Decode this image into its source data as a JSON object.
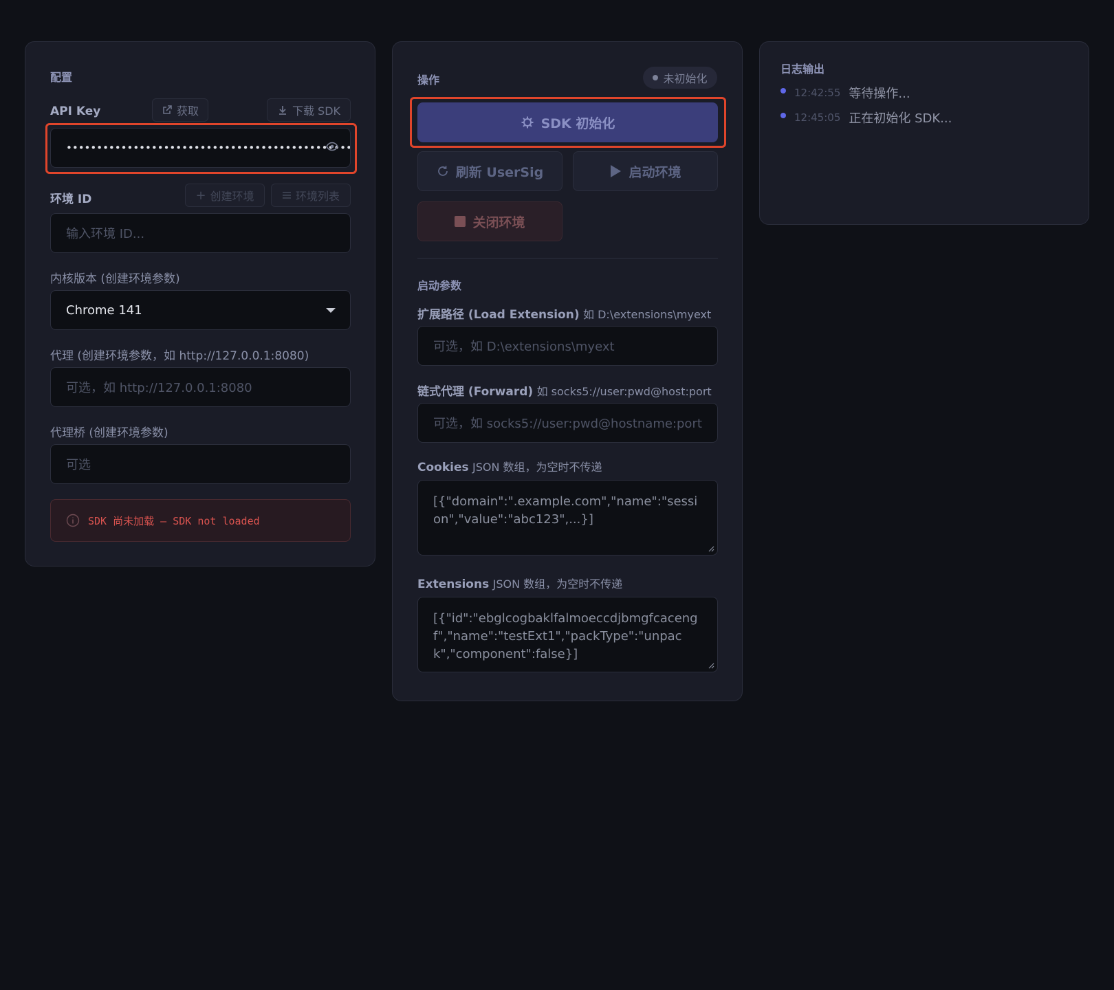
{
  "config": {
    "title": "配置",
    "api_key_label": "API Key",
    "get_label": "获取",
    "download_sdk_label": "下载 SDK",
    "api_key_value": "•••••••••••••••••••••••••••••••••••••••••••••••",
    "env_id_label": "环境 ID",
    "create_env_label": "创建环境",
    "env_list_label": "环境列表",
    "env_id_placeholder": "输入环境 ID...",
    "kernel_label": "内核版本 (创建环境参数)",
    "kernel_value": "Chrome 141",
    "proxy_label": "代理 (创建环境参数，如 http://127.0.0.1:8080)",
    "proxy_placeholder": "可选，如 http://127.0.0.1:8080",
    "bridge_label": "代理桥 (创建环境参数)",
    "bridge_placeholder": "可选",
    "sdk_status_text": "SDK 尚未加载 — SDK not loaded"
  },
  "ops": {
    "title": "操作",
    "status_badge": "未初始化",
    "init_label": "SDK 初始化",
    "refresh_label": "刷新 UserSig",
    "start_label": "启动环境",
    "close_label": "关闭环境",
    "params_title": "启动参数",
    "ext_label_main": "扩展路径 (Load Extension)",
    "ext_label_hint": "如 D:\\extensions\\myext",
    "ext_placeholder": "可选，如 D:\\extensions\\myext",
    "forward_label_main": "链式代理 (Forward)",
    "forward_label_hint": "如 socks5://user:pwd@host:port",
    "forward_placeholder": "可选，如 socks5://user:pwd@hostname:port",
    "cookies_label_main": "Cookies",
    "cookies_label_hint": "JSON 数组，为空时不传递",
    "cookies_value": "[{\"domain\":\".example.com\",\"name\":\"session\",\"value\":\"abc123\",...}]",
    "extensions_label_main": "Extensions",
    "extensions_label_hint": "JSON 数组，为空时不传递",
    "extensions_value": "[{\"id\":\"ebglcogbaklfalmoeccdjbmgfcacengf\",\"name\":\"testExt1\",\"packType\":\"unpack\",\"component\":false}]"
  },
  "log": {
    "title": "日志输出",
    "entries": [
      {
        "time": "12:42:55",
        "message": "等待操作..."
      },
      {
        "time": "12:45:05",
        "message": "正在初始化 SDK..."
      }
    ]
  },
  "colors": {
    "background": "#0f1117",
    "panel": "#1a1c27",
    "accent": "#3c3f7d",
    "highlight": "#e0452b",
    "error_text": "#d9534f",
    "log_dot": "#5f67e8"
  }
}
